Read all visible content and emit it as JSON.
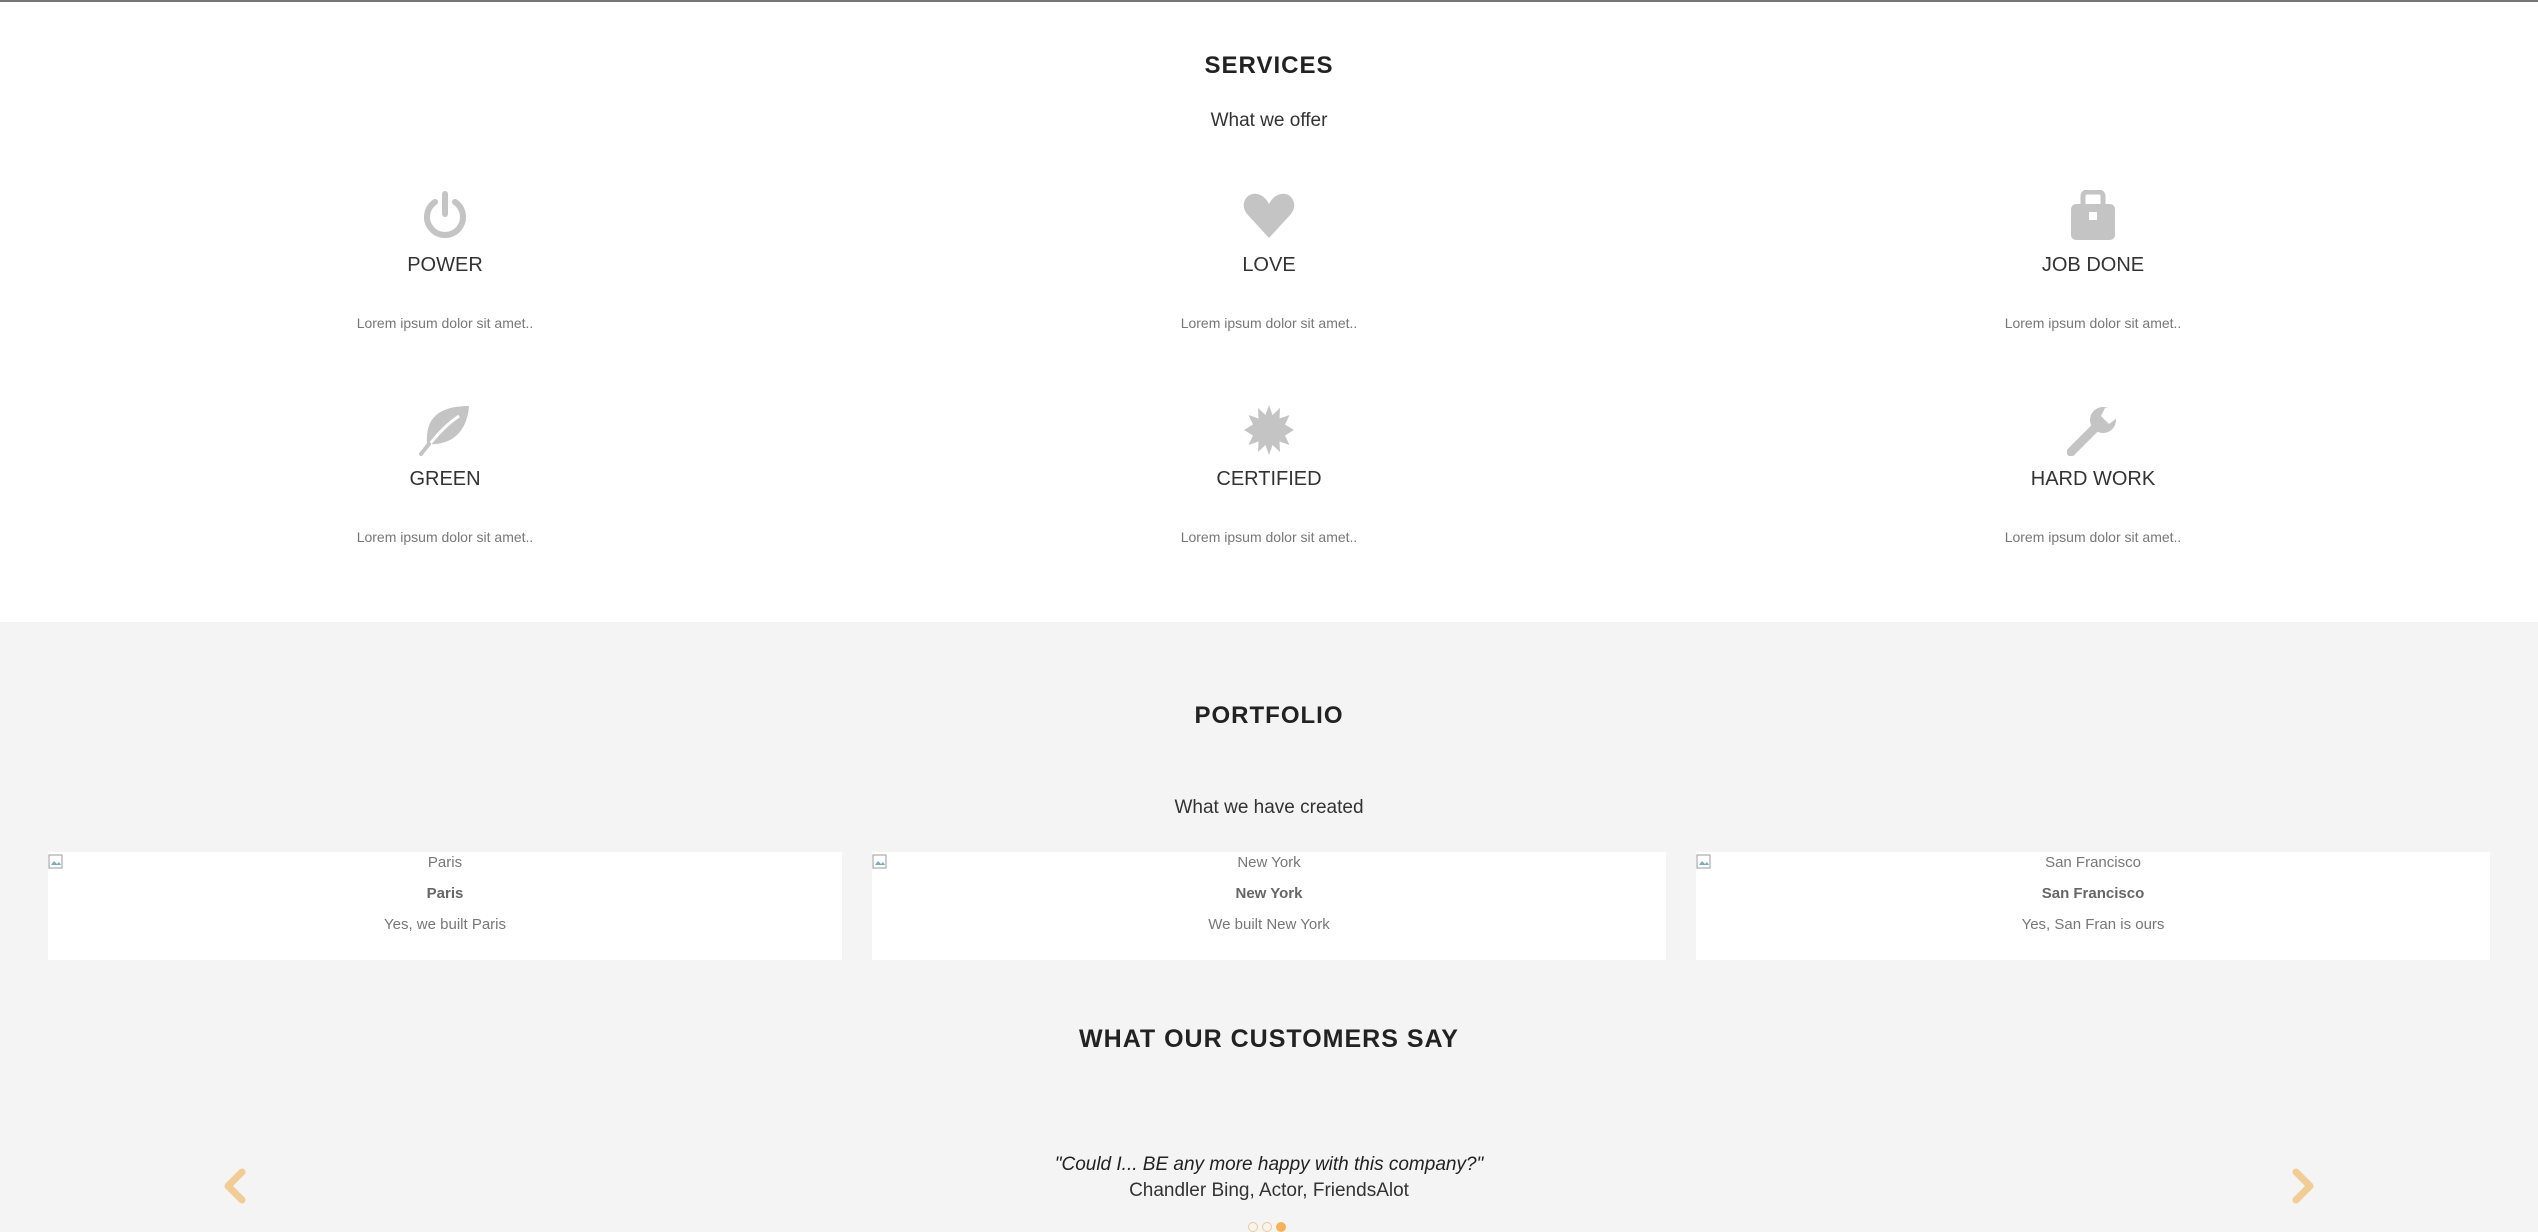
{
  "services": {
    "title": "SERVICES",
    "subtitle": "What we offer",
    "items": [
      {
        "icon": "power-icon",
        "name": "POWER",
        "desc": "Lorem ipsum dolor sit amet.."
      },
      {
        "icon": "heart-icon",
        "name": "LOVE",
        "desc": "Lorem ipsum dolor sit amet.."
      },
      {
        "icon": "briefcase-icon",
        "name": "JOB DONE",
        "desc": "Lorem ipsum dolor sit amet.."
      },
      {
        "icon": "leaf-icon",
        "name": "GREEN",
        "desc": "Lorem ipsum dolor sit amet.."
      },
      {
        "icon": "certificate-icon",
        "name": "CERTIFIED",
        "desc": "Lorem ipsum dolor sit amet.."
      },
      {
        "icon": "wrench-icon",
        "name": "HARD WORK",
        "desc": "Lorem ipsum dolor sit amet.."
      }
    ]
  },
  "portfolio": {
    "title": "PORTFOLIO",
    "subtitle": "What we have created",
    "cards": [
      {
        "alt": "Paris",
        "title": "Paris",
        "sub": "Yes, we built Paris"
      },
      {
        "alt": "New York",
        "title": "New York",
        "sub": "We built New York"
      },
      {
        "alt": "San Francisco",
        "title": "San Francisco",
        "sub": "Yes, San Fran is ours"
      }
    ]
  },
  "customers": {
    "title": "WHAT OUR CUSTOMERS SAY",
    "quote": "\"Could I... BE any more happy with this company?\"",
    "author": "Chandler Bing, Actor, FriendsAlot",
    "active_slide": 3,
    "slide_count": 3
  },
  "colors": {
    "icon": "#c4c4c4",
    "accent": "#f4b357",
    "arrow": "#f2cc95",
    "section_bg": "#f4f4f4"
  }
}
